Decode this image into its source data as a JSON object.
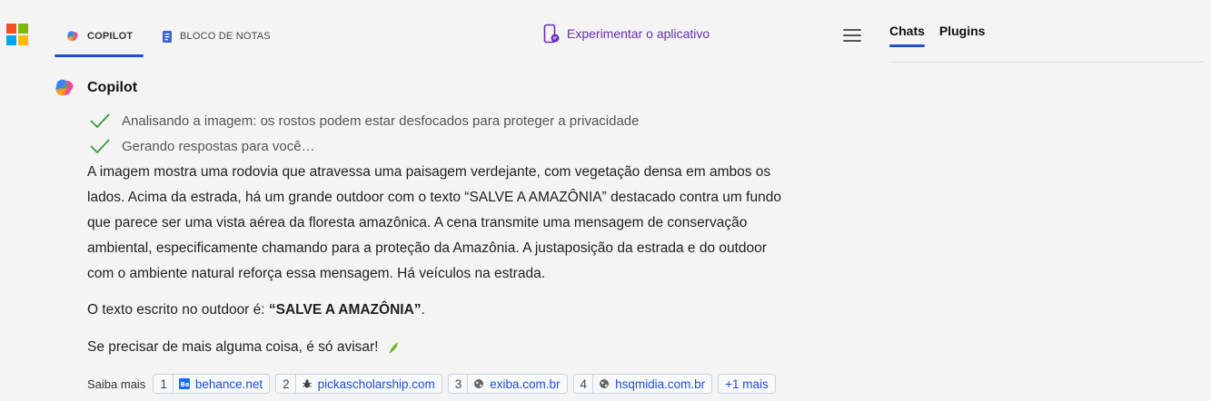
{
  "colors": {
    "ms_red": "#f25022",
    "ms_green": "#7fba00",
    "ms_blue": "#00a4ef",
    "ms_yellow": "#ffb900",
    "accent": "#1d4ed8",
    "purple": "#6a2fb1",
    "check": "#2e9e3e"
  },
  "header": {
    "tabs": [
      {
        "label": "COPILOT",
        "icon": "copilot-icon",
        "active": true
      },
      {
        "label": "BLOCO DE NOTAS",
        "icon": "notebook-icon",
        "active": false
      }
    ],
    "try_app": "Experimentar o aplicativo",
    "menu_icon": "hamburger-icon"
  },
  "sidebar": {
    "tabs": [
      {
        "label": "Chats",
        "active": true
      },
      {
        "label": "Plugins",
        "active": false
      }
    ]
  },
  "message": {
    "author": "Copilot",
    "statuses": [
      "Analisando a imagem: os rostos podem estar desfocados para proteger a privacidade",
      "Gerando respostas para você…"
    ],
    "paragraph_1": [
      "A imagem mostra uma rodovia que atravessa uma paisagem verdejante, com vegetação densa em ambos os",
      "lados. Acima da estrada, há um grande outdoor com o texto “SALVE A AMAZÔNIA” destacado contra um fundo",
      "que parece ser uma vista aérea da floresta amazônica. A cena transmite uma mensagem de conservação",
      "ambiental, especificamente chamando para a proteção da Amazônia. A justaposição da estrada e do outdoor",
      "com o ambiente natural reforça essa mensagem. Há veículos na estrada."
    ],
    "paragraph_2_prefix": "O texto escrito no outdoor é: ",
    "paragraph_2_bold": "“SALVE A AMAZÔNIA”",
    "paragraph_2_suffix": ".",
    "paragraph_3": "Se precisar de mais alguma coisa, é só avisar!",
    "paragraph_3_icon": "leaf-icon"
  },
  "learn_more": {
    "label": "Saiba mais",
    "sources": [
      {
        "num": "1",
        "site": "behance.net",
        "icon": "behance-icon"
      },
      {
        "num": "2",
        "site": "pickascholarship.com",
        "icon": "bug-icon"
      },
      {
        "num": "3",
        "site": "exiba.com.br",
        "icon": "globe-icon"
      },
      {
        "num": "4",
        "site": "hsqmidia.com.br",
        "icon": "globe-icon"
      }
    ],
    "more": "+1 mais"
  }
}
